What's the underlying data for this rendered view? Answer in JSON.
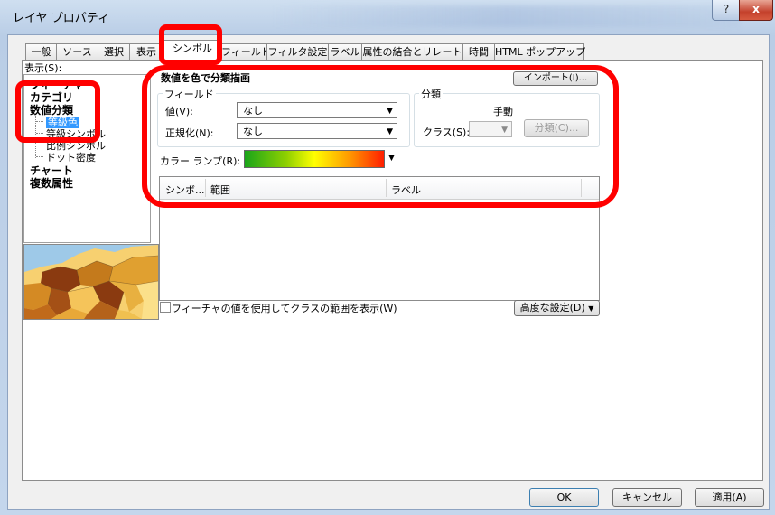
{
  "window": {
    "title": "レイヤ プロパティ",
    "help_glyph": "?",
    "close_glyph": "x"
  },
  "tabs": [
    {
      "label": "一般"
    },
    {
      "label": "ソース"
    },
    {
      "label": "選択"
    },
    {
      "label": "表示"
    },
    {
      "label": "シンボル",
      "active": true
    },
    {
      "label": "フィールド"
    },
    {
      "label": "フィルタ設定"
    },
    {
      "label": "ラベル"
    },
    {
      "label": "属性の結合とリレート"
    },
    {
      "label": "時間"
    },
    {
      "label": "HTML ポップアップ"
    }
  ],
  "show": {
    "label": "表示(S):",
    "items": {
      "features": "フィーチャ",
      "categories": "カテゴリ",
      "quantities": "数値分類",
      "graduated_colors": "等級色",
      "graduated_symbols": "等級シンボル",
      "proportional_symbols": "比例シンボル",
      "dot_density": "ドット密度",
      "charts": "チャート",
      "multiple_attributes": "複数属性"
    }
  },
  "main": {
    "group_title": "数値を色で分類描画",
    "import_label": "インポート(I)...",
    "fields": {
      "legend": "フィールド",
      "value_label": "値(V):",
      "value": "なし",
      "normalization_label": "正規化(N):",
      "normalization": "なし"
    },
    "classification": {
      "legend": "分類",
      "method": "手動",
      "classes_label": "クラス(S):",
      "classify_button": "分類(C)..."
    },
    "color_ramp_label": "カラー ランプ(R):",
    "columns": {
      "symbol": "シンボ...",
      "range": "範囲",
      "label": "ラベル"
    },
    "show_class_ranges": "フィーチャの値を使用してクラスの範囲を表示(W)",
    "advanced_button": "高度な設定(D)"
  },
  "footer": {
    "ok": "OK",
    "cancel": "キャンセル",
    "apply": "適用(A)"
  },
  "colors": {
    "callout": "#ff0000",
    "selection": "#3399ff"
  }
}
